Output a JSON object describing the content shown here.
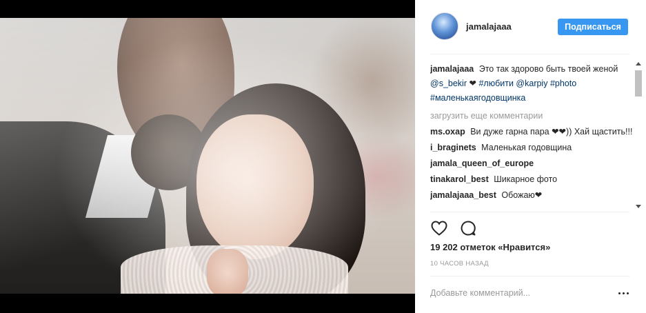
{
  "post": {
    "photo_alt": "wedding-photo",
    "author": "jamalajaaa",
    "follow_label": "Подписаться"
  },
  "caption": {
    "user": "jamalajaaa",
    "text_before": "Это так здорово быть твоей женой",
    "mention1": "@s_bekir",
    "heart": "❤",
    "hashtag1": "#любити",
    "mention2": "@karpiy",
    "hashtag2": "#photo",
    "hashtag3": "#маленькаягодовщинка"
  },
  "load_more": "загрузить еще комментарии",
  "comments": [
    {
      "user": "ms.oxap",
      "text": "Ви дуже гарна пара ❤❤)) Хай щастить!!! "
    },
    {
      "user": "i_braginets",
      "text": "Маленькая годовщина "
    },
    {
      "user": "jamala_queen_of_europe",
      "text": ""
    },
    {
      "user": "tinakarol_best",
      "text": "Шикарное фото"
    },
    {
      "user": "jamalajaaa_best",
      "text": "Обожаю❤"
    }
  ],
  "likes_text": "19 202 отметок «Нравится»",
  "time_text": "10 часов назад",
  "comment_placeholder": "Добавьте комментарий...",
  "colors": {
    "follow_button": "#3897f0",
    "link": "#003569"
  },
  "icons": [
    "heart-icon",
    "comment-icon",
    "more-options-icon"
  ]
}
